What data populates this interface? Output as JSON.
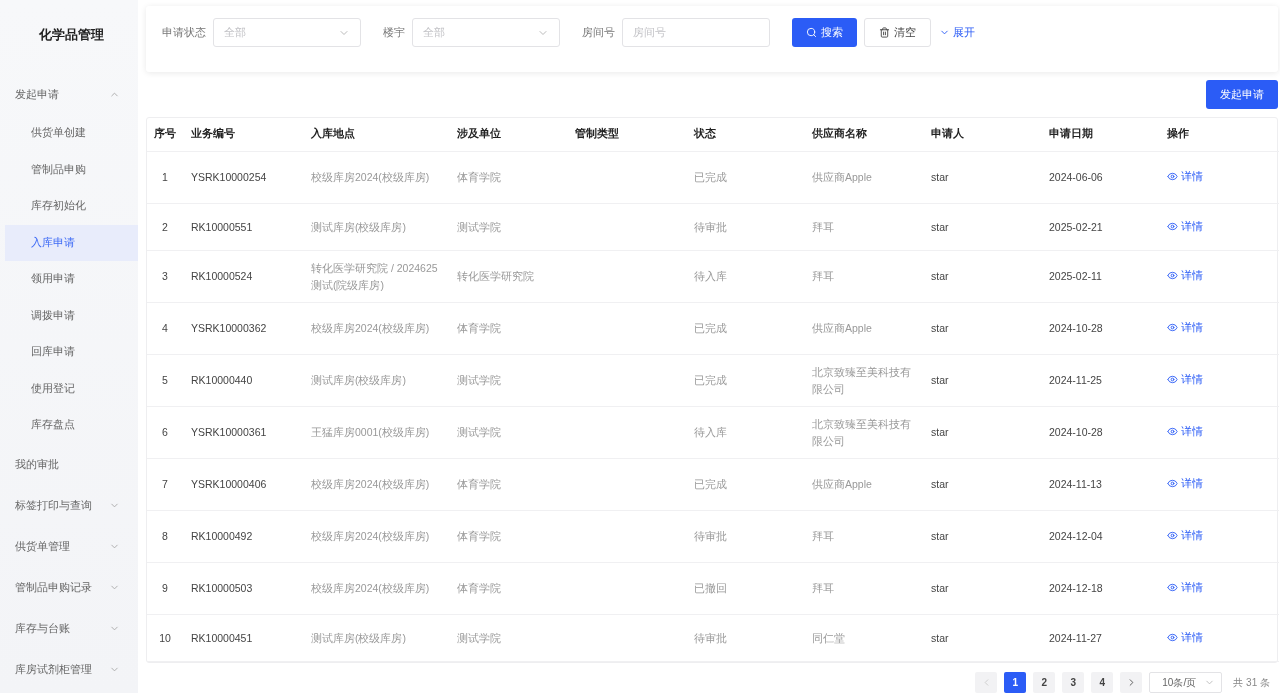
{
  "sidebar": {
    "title": "化学品管理",
    "items": [
      {
        "label": "发起申请",
        "expanded": true,
        "children": [
          {
            "label": "供货单创建",
            "selected": false
          },
          {
            "label": "管制品申购",
            "selected": false
          },
          {
            "label": "库存初始化",
            "selected": false
          },
          {
            "label": "入库申请",
            "selected": true
          },
          {
            "label": "领用申请",
            "selected": false
          },
          {
            "label": "调拨申请",
            "selected": false
          },
          {
            "label": "回库申请",
            "selected": false
          },
          {
            "label": "使用登记",
            "selected": false
          },
          {
            "label": "库存盘点",
            "selected": false
          }
        ]
      },
      {
        "label": "我的审批"
      },
      {
        "label": "标签打印与查询",
        "expanded": false
      },
      {
        "label": "供货单管理",
        "expanded": false
      },
      {
        "label": "管制品申购记录",
        "expanded": false
      },
      {
        "label": "库存与台账",
        "expanded": false
      },
      {
        "label": "库房试剂柜管理",
        "expanded": false
      }
    ]
  },
  "filters": [
    {
      "kind": "select",
      "label": "申请状态",
      "placeholder": "全部"
    },
    {
      "kind": "select",
      "label": "楼宇",
      "placeholder": "全部"
    },
    {
      "kind": "input",
      "label": "房间号",
      "placeholder": "房间号"
    }
  ],
  "filter_actions": {
    "search": "搜索",
    "clear": "清空",
    "expand": "展开"
  },
  "primary_action": "发起申请",
  "table": {
    "columns": [
      "序号",
      "业务编号",
      "入库地点",
      "涉及单位",
      "管制类型",
      "状态",
      "供应商名称",
      "申请人",
      "申请日期",
      "操作"
    ],
    "rows": [
      [
        "1",
        "YSRK10000254",
        "校级库房2024(校级库房)",
        "体育学院",
        "",
        "已完成",
        "供应商Apple",
        "star",
        "2024-06-06",
        "详情"
      ],
      [
        "2",
        "RK10000551",
        "测试库房(校级库房)",
        "测试学院",
        "",
        "待审批",
        "拜耳",
        "star",
        "2025-02-21",
        "详情"
      ],
      [
        "3",
        "RK10000524",
        "转化医学研究院 / 2024625测试(院级库房)",
        "转化医学研究院",
        "",
        "待入库",
        "拜耳",
        "star",
        "2025-02-11",
        "详情"
      ],
      [
        "4",
        "YSRK10000362",
        "校级库房2024(校级库房)",
        "体育学院",
        "",
        "已完成",
        "供应商Apple",
        "star",
        "2024-10-28",
        "详情"
      ],
      [
        "5",
        "RK10000440",
        "测试库房(校级库房)",
        "测试学院",
        "",
        "已完成",
        "北京致臻至美科技有限公司",
        "star",
        "2024-11-25",
        "详情"
      ],
      [
        "6",
        "YSRK10000361",
        "王猛库房0001(校级库房)",
        "测试学院",
        "",
        "待入库",
        "北京致臻至美科技有限公司",
        "star",
        "2024-10-28",
        "详情"
      ],
      [
        "7",
        "YSRK10000406",
        "校级库房2024(校级库房)",
        "体育学院",
        "",
        "已完成",
        "供应商Apple",
        "star",
        "2024-11-13",
        "详情"
      ],
      [
        "8",
        "RK10000492",
        "校级库房2024(校级库房)",
        "体育学院",
        "",
        "待审批",
        "拜耳",
        "star",
        "2024-12-04",
        "详情"
      ],
      [
        "9",
        "RK10000503",
        "校级库房2024(校级库房)",
        "体育学院",
        "",
        "已撤回",
        "拜耳",
        "star",
        "2024-12-18",
        "详情"
      ],
      [
        "10",
        "RK10000451",
        "测试库房(校级库房)",
        "测试学院",
        "",
        "待审批",
        "同仁堂",
        "star",
        "2024-11-27",
        "详情"
      ]
    ]
  },
  "pagination": {
    "prev_disabled": true,
    "pages": [
      {
        "label": "1",
        "selected": true
      },
      {
        "label": "2",
        "selected": false
      },
      {
        "label": "3",
        "selected": false
      },
      {
        "label": "4",
        "selected": false
      }
    ],
    "page_size": "10条/页",
    "total": "共 31 条"
  }
}
